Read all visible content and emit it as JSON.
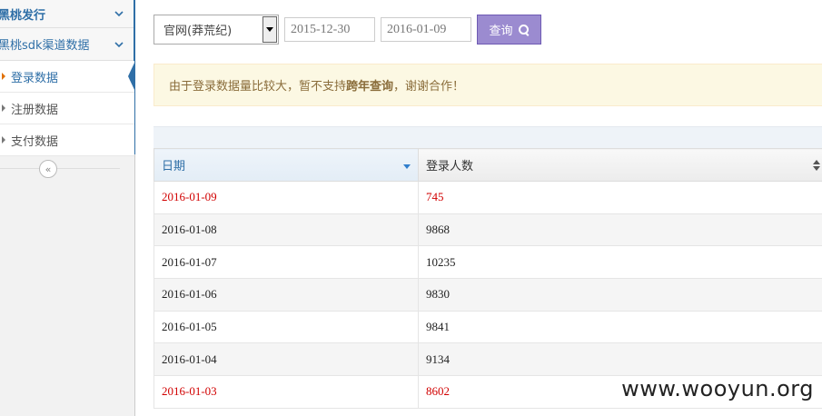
{
  "sidebar": {
    "groups": [
      {
        "label": "黑桃发行"
      },
      {
        "label": "黑桃sdk渠道数据"
      }
    ],
    "items": [
      {
        "label": "登录数据",
        "active": true
      },
      {
        "label": "注册数据",
        "active": false
      },
      {
        "label": "支付数据",
        "active": false
      }
    ],
    "collapse_glyph": "«"
  },
  "filters": {
    "channel_value": "官网(莽荒纪)",
    "start_date": "2015-12-30",
    "end_date": "2016-01-09",
    "search_label": "查询"
  },
  "notice": {
    "prefix": "由于登录数据量比较大，暂不支持",
    "emphasis": "跨年查询",
    "suffix": "，谢谢合作！"
  },
  "table": {
    "headers": [
      "日期",
      "登录人数"
    ],
    "rows": [
      {
        "date": "2016-01-09",
        "count": "745",
        "alert": true
      },
      {
        "date": "2016-01-08",
        "count": "9868",
        "alert": false
      },
      {
        "date": "2016-01-07",
        "count": "10235",
        "alert": false
      },
      {
        "date": "2016-01-06",
        "count": "9830",
        "alert": false
      },
      {
        "date": "2016-01-05",
        "count": "9841",
        "alert": false
      },
      {
        "date": "2016-01-04",
        "count": "9134",
        "alert": false
      },
      {
        "date": "2016-01-03",
        "count": "8602",
        "alert": true
      }
    ]
  },
  "watermark": "www.wooyun.org",
  "colors": {
    "accent": "#2f6fa7",
    "alert": "#d10000",
    "button": "#9b8bd0",
    "notice_bg": "#fcf8e3"
  }
}
